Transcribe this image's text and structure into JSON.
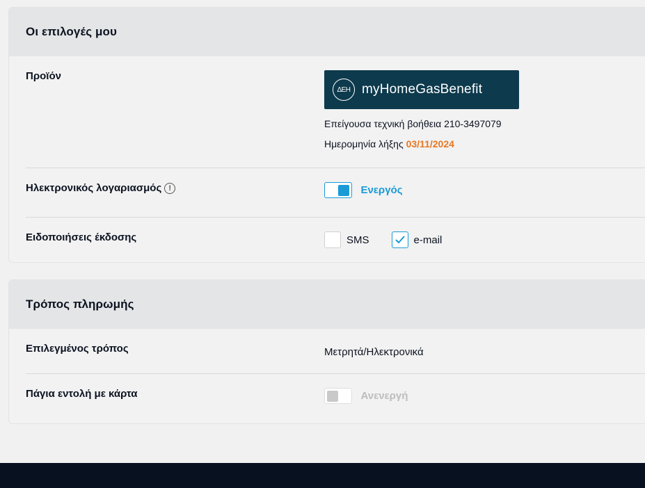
{
  "options_card": {
    "title": "Οι επιλογές μου",
    "product": {
      "label": "Προϊόν",
      "logo_brand": "ΔΕΗ",
      "logo_text": "myHomeGasBenefit",
      "support_text": "Επείγουσα τεχνική βοήθεια 210-3497079",
      "expiry_label": "Ημερομηνία λήξης",
      "expiry_date": "03/11/2024"
    },
    "e_bill": {
      "label": "Ηλεκτρονικός λογαριασμός",
      "info_icon": "info-icon",
      "status": "Ενεργός",
      "enabled": true
    },
    "notifications": {
      "label": "Ειδοποιήσεις έκδοσης",
      "sms_label": "SMS",
      "sms_checked": false,
      "email_label": "e-mail",
      "email_checked": true
    }
  },
  "payment_card": {
    "title": "Τρόπος πληρωμής",
    "selected_method": {
      "label": "Επιλεγμένος τρόπος",
      "value": "Μετρητά/Ηλεκτρονικά"
    },
    "standing_order": {
      "label": "Πάγια εντολή με κάρτα",
      "status": "Ανενεργή",
      "enabled": false
    }
  },
  "colors": {
    "accent": "#1a9bd7",
    "expiry": "#e87722",
    "logo_bg": "#0d3a4d",
    "footer": "#07111f"
  }
}
